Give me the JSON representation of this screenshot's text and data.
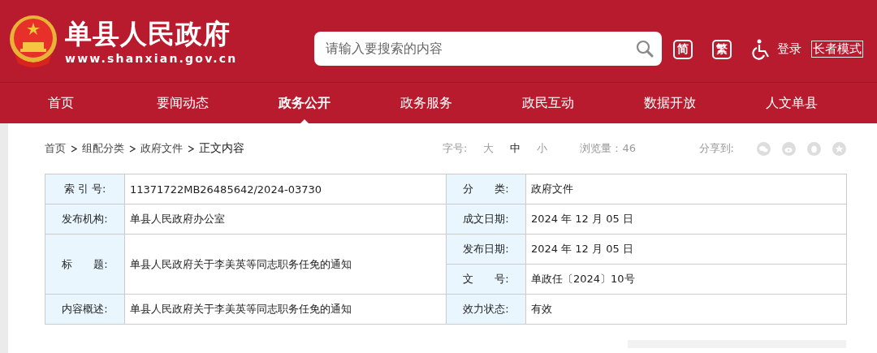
{
  "header": {
    "site_name": "单县人民政府",
    "site_url": "www.shanxian.gov.cn",
    "search": {
      "placeholder": "请输入要搜索的内容"
    },
    "simplified": "简",
    "traditional": "繁",
    "login": "登录",
    "elder_mode": "长者模式"
  },
  "nav": [
    {
      "label": "首页",
      "selected": false
    },
    {
      "label": "要闻动态",
      "selected": false
    },
    {
      "label": "政务公开",
      "selected": true
    },
    {
      "label": "政务服务",
      "selected": false
    },
    {
      "label": "政民互动",
      "selected": false
    },
    {
      "label": "数据开放",
      "selected": false
    },
    {
      "label": "人文单县",
      "selected": false
    }
  ],
  "breadcrumb": [
    "首页",
    "组配分类",
    "政府文件",
    "正文内容"
  ],
  "font_size": {
    "label": "字号:",
    "options": [
      {
        "label": "大",
        "selected": false
      },
      {
        "label": "中",
        "selected": true
      },
      {
        "label": "小",
        "selected": false
      }
    ]
  },
  "views": "浏览量：46",
  "share": {
    "label": "分享到:"
  },
  "table": {
    "rows": [
      {
        "left": {
          "label": "索 引 号:",
          "value": "11371722MB26485642/2024-03730"
        },
        "right": [
          {
            "label": "分　　类:",
            "value": "政府文件"
          }
        ]
      },
      {
        "left": {
          "label": "发布机构:",
          "value": "单县人民政府办公室"
        },
        "right": [
          {
            "label": "成文日期:",
            "value": "2024 年 12 月 05 日"
          }
        ]
      },
      {
        "left": {
          "label": "标　　题:",
          "value": "单县人民政府关于李美英等同志职务任免的通知"
        },
        "right": [
          {
            "label": "发布日期:",
            "value": "2024 年 12 月 05 日"
          },
          {
            "label": "文　　号:",
            "value": "单政任〔2024〕10号"
          }
        ]
      },
      {
        "left": {
          "label": "内容概述:",
          "value": "单县人民政府关于李美英等同志职务任免的通知"
        },
        "right": [
          {
            "label": "效力状态:",
            "value": "有效"
          }
        ]
      }
    ]
  }
}
